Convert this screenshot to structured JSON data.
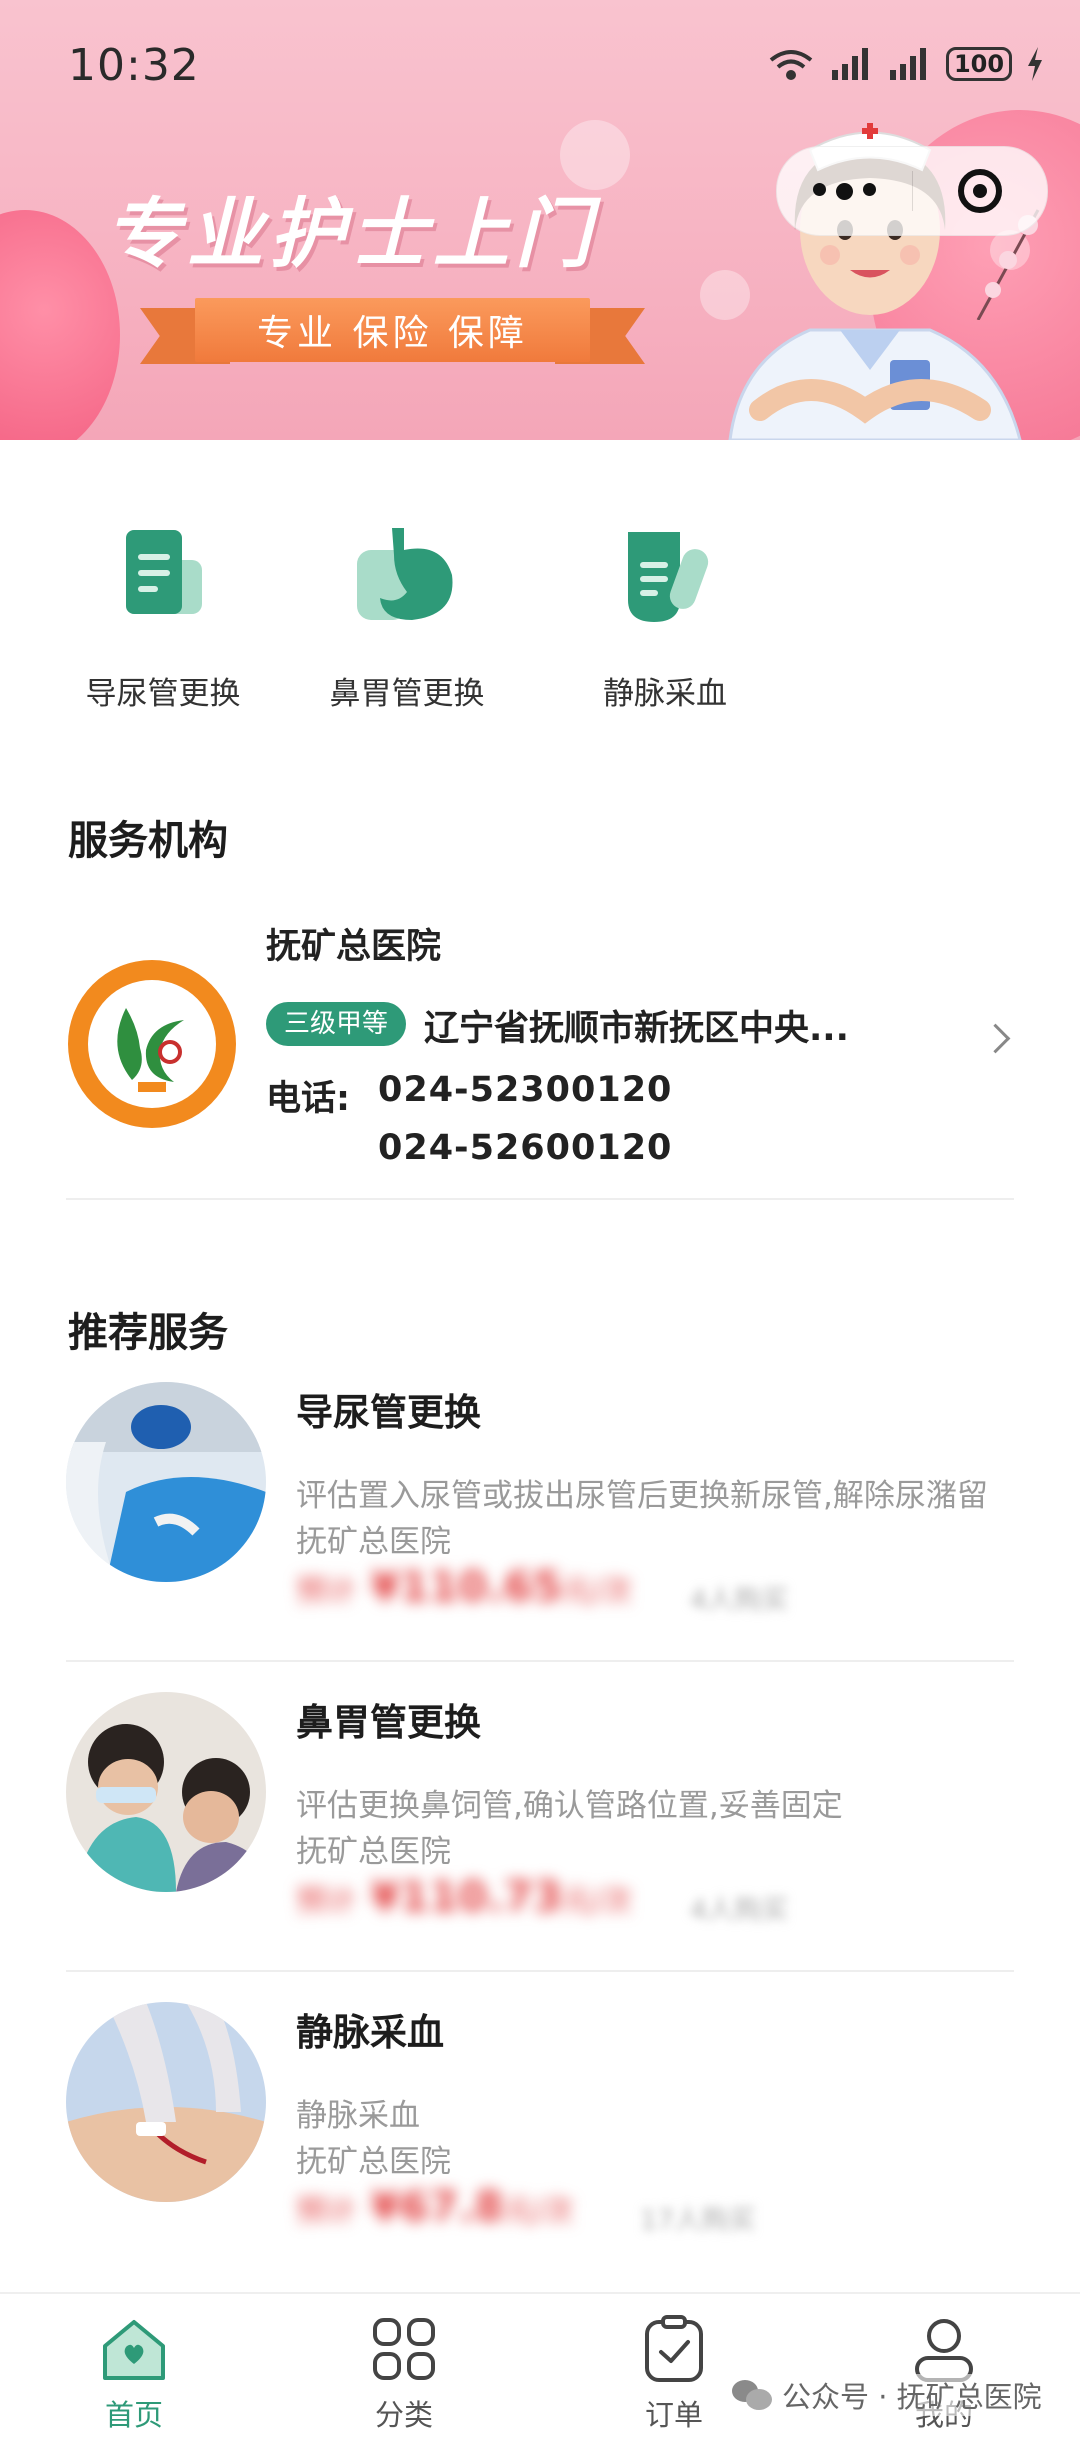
{
  "status_bar": {
    "time": "10:32",
    "battery": "100"
  },
  "banner": {
    "title": "专业护士上门",
    "ribbon": "专业 保险 保障"
  },
  "services": [
    {
      "label": "导尿管更换",
      "icon": "document-icon"
    },
    {
      "label": "鼻胃管更换",
      "icon": "stomach-icon"
    },
    {
      "label": "静脉采血",
      "icon": "test-tube-icon"
    }
  ],
  "institution": {
    "section_title": "服务机构",
    "name": "抚矿总医院",
    "grade": "三级甲等",
    "address": "辽宁省抚顺市新抚区中央...",
    "phone_label": "电话:",
    "phone1": "024-52300120",
    "phone2": "024-52600120"
  },
  "recommended": {
    "section_title": "推荐服务",
    "items": [
      {
        "title": "导尿管更换",
        "desc": "评估置入尿管或拔出尿管后更换新尿管,解除尿潴留",
        "org": "抚矿总医院",
        "price_prefix": "预计",
        "price": "¥110.65",
        "price_unit": "元/次",
        "sold": "4人购买"
      },
      {
        "title": "鼻胃管更换",
        "desc": "评估更换鼻饲管,确认管路位置,妥善固定",
        "org": "抚矿总医院",
        "price_prefix": "预计",
        "price": "¥110.73",
        "price_unit": "元/次",
        "sold": "4人购买"
      },
      {
        "title": "静脉采血",
        "desc": "静脉采血",
        "org": "抚矿总医院",
        "price_prefix": "预计",
        "price": "¥67.8",
        "price_unit": "元/次",
        "sold": "17人购买"
      }
    ]
  },
  "tabs": [
    {
      "label": "首页",
      "icon": "home-icon",
      "active": true
    },
    {
      "label": "分类",
      "icon": "grid-icon",
      "active": false
    },
    {
      "label": "订单",
      "icon": "order-icon",
      "active": false
    },
    {
      "label": "我的",
      "icon": "user-icon",
      "active": false
    }
  ],
  "watermark": "公众号 · 抚矿总医院",
  "colors": {
    "accent": "#2e9a78",
    "price": "#e34a4a",
    "banner_pink": "#f7b4c3"
  }
}
